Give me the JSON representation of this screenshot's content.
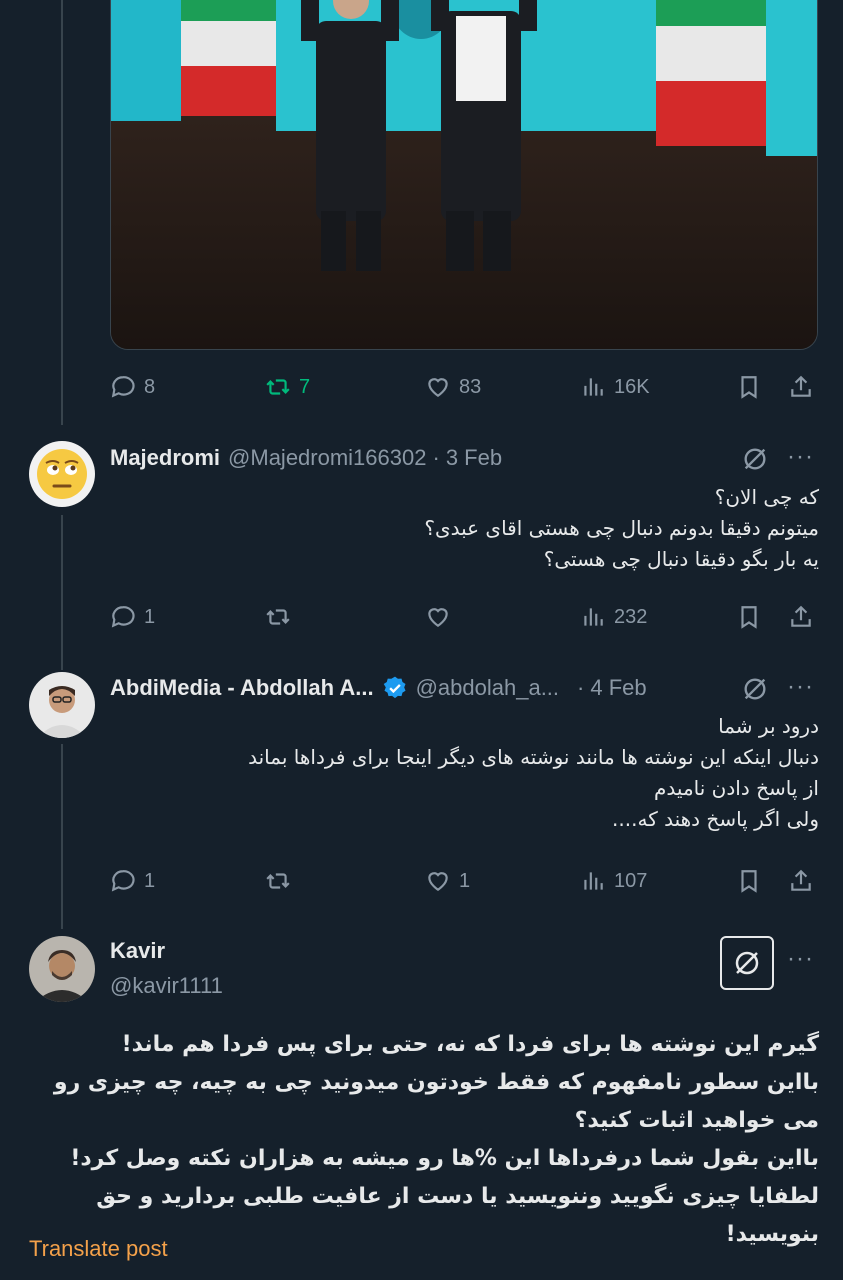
{
  "media": {
    "alt": ""
  },
  "post_main": {
    "replies": "8",
    "reposts": "7",
    "likes": "83",
    "views": "16K"
  },
  "reply1": {
    "name": "Majedromi",
    "handle": "@Majedromi166302",
    "dot": "·",
    "date": "3 Feb",
    "lines": [
      "که چی الان؟",
      "میتونم دقیقا بدونم دنبال چی هستی اقای عبدی؟",
      "یه بار  بگو دقیقا دنبال چی هستی؟"
    ],
    "replies": "1",
    "reposts": "",
    "likes": "",
    "views": "232"
  },
  "reply2": {
    "name": "AbdiMedia - Abdollah A...",
    "handle": "@abdolah_a...",
    "dot": "·",
    "date": "4 Feb",
    "lines": [
      "درود بر شما",
      "دنبال اینکه این نوشته ها مانند نوشته های دیگر اینجا برای فرداها بماند",
      "از پاسخ دادن نامیدم",
      "ولی اگر پاسخ دهند که...."
    ],
    "replies": "1",
    "reposts": "",
    "likes": "1",
    "views": "107"
  },
  "reply3": {
    "name": "Kavir",
    "handle": "@kavir1111",
    "lines": [
      "گیرم این نوشته ها برای فردا که نه، حتی برای پس فردا هم ماند!",
      "بااین سطور نامفهوم که فقط خودتون میدونید چی به چیه، چه چیزی رو می خواهید اثبات کنید؟",
      "بااین بقول شما درفرداها این %ها رو میشه به هزاران نکته وصل کرد!",
      "لطفایا چیزی نگویید وننویسید یا دست از عافیت طلبی بردارید و حق بنویسید!"
    ]
  },
  "translate_label": "Translate post",
  "more_label": "···",
  "colors": {
    "bg": "#15202b",
    "text": "#e7e9ea",
    "muted": "#8b98a5",
    "repost_active": "#00ba7c",
    "verified": "#1d9bf0",
    "translate": "#f4a14a"
  },
  "icons": [
    "reply-icon",
    "repost-icon",
    "like-icon",
    "views-icon",
    "bookmark-icon",
    "share-icon",
    "grok-icon",
    "more-icon",
    "verified-icon"
  ]
}
